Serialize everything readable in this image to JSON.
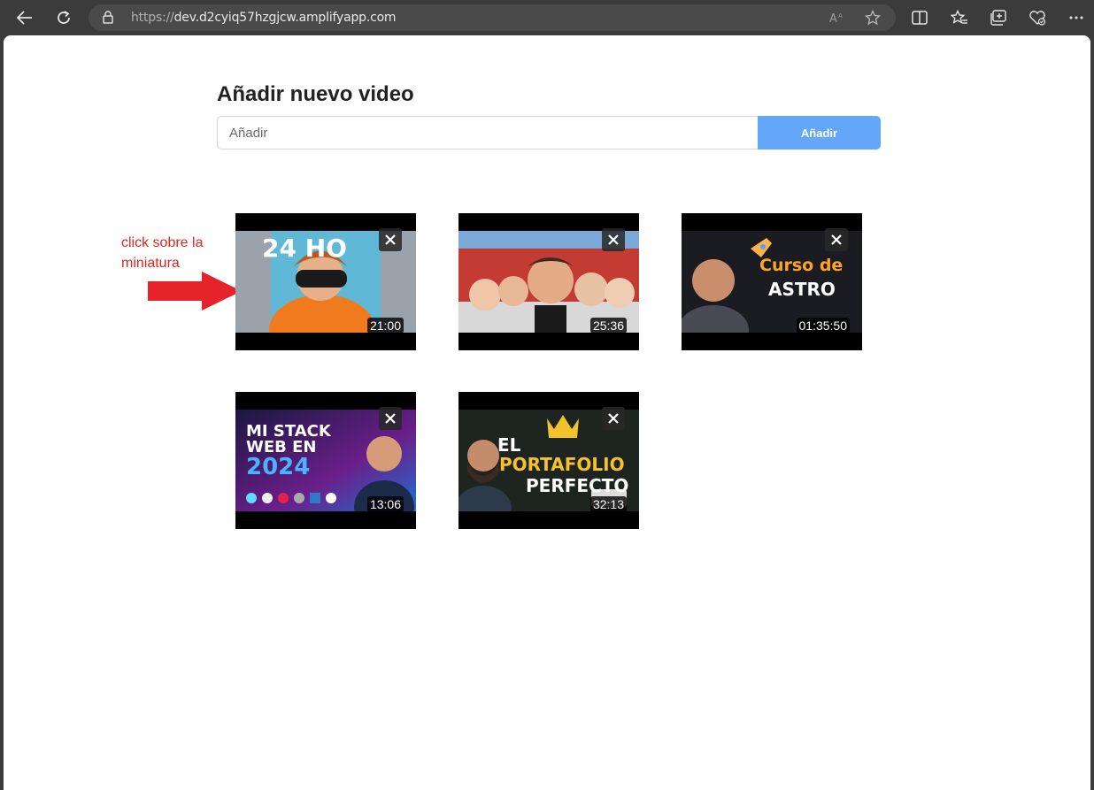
{
  "browser": {
    "url_scheme": "https://",
    "url_host": "dev.d2cyiq57hzgjcw.amplifyapp.com",
    "icons": [
      "back-arrow-icon",
      "refresh-icon",
      "lock-icon",
      "read-aloud-icon",
      "favorite-star-icon",
      "split-screen-icon",
      "favorites-icon",
      "collections-icon",
      "browser-essentials-icon",
      "more-options-icon"
    ]
  },
  "add_form": {
    "title": "Añadir nuevo video",
    "input_placeholder": "Añadir",
    "input_value": "",
    "button_label": "Añadir",
    "button_color": "#64a6f7"
  },
  "annotation": {
    "text": "click sobre la miniatura",
    "color": "#e0261f"
  },
  "videos": [
    {
      "duration": "21:00",
      "thumb_text": "24 HO"
    },
    {
      "duration": "25:36",
      "thumb_text": ""
    },
    {
      "duration": "01:35:50",
      "thumb_text_1": "Curso de",
      "thumb_text_2": "ASTRO"
    },
    {
      "duration": "13:06",
      "thumb_text_1": "MI STACK",
      "thumb_text_2": "WEB EN",
      "thumb_text_3": "2024"
    },
    {
      "duration": "32:13",
      "thumb_text_1": "EL",
      "thumb_text_2": "PORTAFOLIO",
      "thumb_text_3": "PERFECTO"
    }
  ]
}
